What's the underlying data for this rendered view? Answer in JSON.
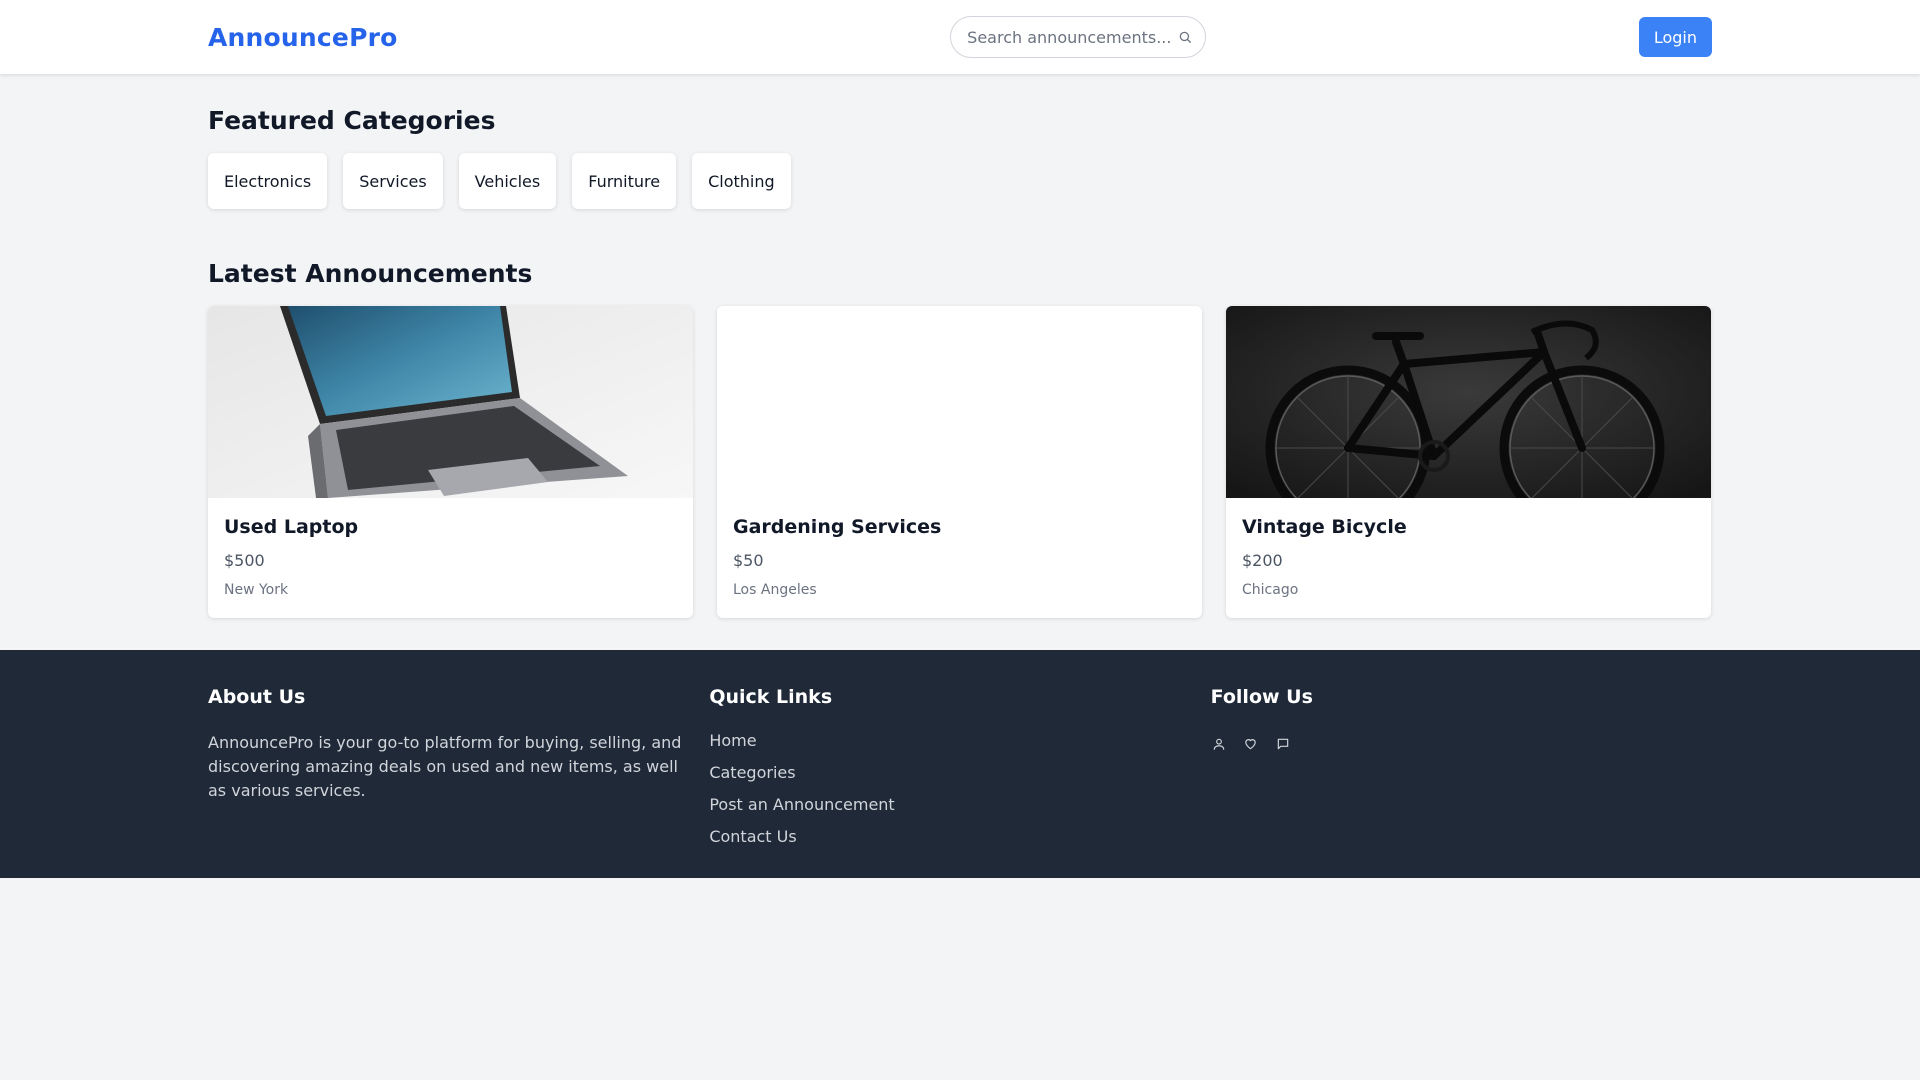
{
  "header": {
    "logo": "AnnouncePro",
    "search_placeholder": "Search announcements...",
    "login_label": "Login",
    "search_icon": "search-icon"
  },
  "featured": {
    "title": "Featured Categories",
    "categories": [
      "Electronics",
      "Services",
      "Vehicles",
      "Furniture",
      "Clothing"
    ]
  },
  "latest": {
    "title": "Latest Announcements",
    "cards": [
      {
        "title": "Used Laptop",
        "price": "$500",
        "location": "New York",
        "image": "laptop-photo"
      },
      {
        "title": "Gardening Services",
        "price": "$50",
        "location": "Los Angeles",
        "image": "blank"
      },
      {
        "title": "Vintage Bicycle",
        "price": "$200",
        "location": "Chicago",
        "image": "bicycle-photo"
      }
    ]
  },
  "footer": {
    "about": {
      "title": "About Us",
      "text": "AnnouncePro is your go-to platform for buying, selling, and discovering amazing deals on used and new items, as well as various services."
    },
    "quick_links": {
      "title": "Quick Links",
      "items": [
        "Home",
        "Categories",
        "Post an Announcement",
        "Contact Us"
      ]
    },
    "follow": {
      "title": "Follow Us",
      "icons": [
        "user-icon",
        "heart-icon",
        "chat-icon"
      ]
    }
  },
  "colors": {
    "brand": "#2563eb",
    "button": "#3b82f6",
    "page_bg": "#f3f4f6",
    "footer_bg": "#1f2937"
  }
}
